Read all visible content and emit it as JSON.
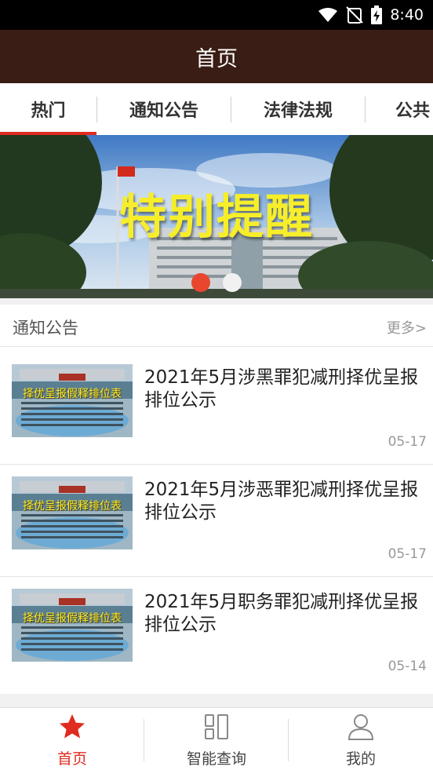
{
  "status_bar": {
    "time": "8:40"
  },
  "header": {
    "title": "首页"
  },
  "tabs": [
    {
      "label": "热门"
    },
    {
      "label": "通知公告"
    },
    {
      "label": "法律法规"
    },
    {
      "label": "公共"
    }
  ],
  "banner": {
    "caption": "特别提醒",
    "active_slide": 1,
    "slide_count": 2
  },
  "section": {
    "title": "通知公告",
    "more": "更多>"
  },
  "news": [
    {
      "thumb_caption": "择优呈报假释排位表",
      "title": "2021年5月涉黑罪犯减刑择优呈报排位公示",
      "date": "05-17"
    },
    {
      "thumb_caption": "择优呈报假释排位表",
      "title": "2021年5月涉恶罪犯减刑择优呈报排位公示",
      "date": "05-17"
    },
    {
      "thumb_caption": "择优呈报假释排位表",
      "title": "2021年5月职务罪犯减刑择优呈报排位公示",
      "date": "05-14"
    }
  ],
  "bottom_nav": [
    {
      "label": "首页",
      "icon": "star-icon",
      "active": true
    },
    {
      "label": "智能查询",
      "icon": "grid-icon",
      "active": false
    },
    {
      "label": "我的",
      "icon": "user-icon",
      "active": false
    }
  ],
  "colors": {
    "header_bg": "#3a1d14",
    "accent": "#e02b20",
    "banner_text": "#f7ee2a"
  }
}
